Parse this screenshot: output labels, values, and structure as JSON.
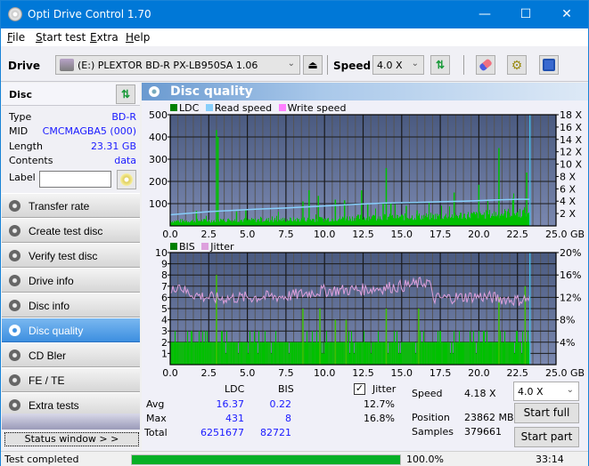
{
  "window": {
    "title": "Opti Drive Control 1.70",
    "minimize": "—",
    "maximize": "☐",
    "close": "✕"
  },
  "menu": [
    {
      "label": "File",
      "accel": "F",
      "rest": "ile"
    },
    {
      "label": "Start test",
      "accel": "S",
      "rest": "tart test"
    },
    {
      "label": "Extra",
      "accel": "E",
      "rest": "xtra"
    },
    {
      "label": "Help",
      "accel": "H",
      "rest": "elp"
    }
  ],
  "toolbar": {
    "drive_label": "Drive",
    "drive_value": "(E:)  PLEXTOR BD-R  PX-LB950SA 1.06",
    "speed_label": "Speed",
    "speed_value": "4.0 X",
    "icons": [
      "drive-icon",
      "eject-icon",
      "refresh-icon",
      "eraser-icon",
      "settings-icon",
      "save-icon"
    ]
  },
  "disc": {
    "header": "Disc",
    "fields": [
      {
        "key": "Type",
        "value": "BD-R"
      },
      {
        "key": "MID",
        "value": "CMCMAGBA5 (000)"
      },
      {
        "key": "Length",
        "value": "23.31 GB"
      },
      {
        "key": "Contents",
        "value": "data"
      }
    ],
    "label_key": "Label",
    "label_value": ""
  },
  "nav": [
    {
      "label": "Transfer rate",
      "active": false
    },
    {
      "label": "Create test disc",
      "active": false
    },
    {
      "label": "Verify test disc",
      "active": false
    },
    {
      "label": "Drive info",
      "active": false
    },
    {
      "label": "Disc info",
      "active": false
    },
    {
      "label": "Disc quality",
      "active": true
    },
    {
      "label": "CD Bler",
      "active": false
    },
    {
      "label": "FE / TE",
      "active": false
    },
    {
      "label": "Extra tests",
      "active": false
    }
  ],
  "status_window_button": "Status window > >",
  "panel": {
    "title": "Disc quality"
  },
  "chart_data": [
    {
      "type": "bar",
      "title": "",
      "legend": [
        {
          "name": "LDC",
          "color": "#008000"
        },
        {
          "name": "Read speed",
          "color": "#87cefa"
        },
        {
          "name": "Write speed",
          "color": "#ff80ff"
        }
      ],
      "legend_position": "top-left",
      "xlabel": "GB",
      "xlim": [
        0,
        25
      ],
      "x_ticks": [
        "0.0",
        "2.5",
        "5.0",
        "7.5",
        "10.0",
        "12.5",
        "15.0",
        "17.5",
        "20.0",
        "22.5",
        "25.0 GB"
      ],
      "ylim": [
        0,
        500
      ],
      "y_ticks": [
        "100",
        "200",
        "300",
        "400",
        "500"
      ],
      "y2lim": [
        0,
        18
      ],
      "y2_ticks": [
        "2 X",
        "4 X",
        "6 X",
        "8 X",
        "10 X",
        "12 X",
        "14 X",
        "16 X",
        "18 X"
      ],
      "grid": true,
      "end_marker_gb": 23.31,
      "ldc_baseline": [
        [
          0,
          22
        ],
        [
          2.5,
          24
        ],
        [
          5,
          26
        ],
        [
          7.5,
          28
        ],
        [
          10,
          30
        ],
        [
          12.5,
          38
        ],
        [
          15,
          40
        ],
        [
          17.5,
          44
        ],
        [
          20,
          50
        ],
        [
          22.5,
          60
        ],
        [
          23.3,
          62
        ]
      ],
      "ldc_spikes": [
        [
          1.7,
          68
        ],
        [
          3.0,
          431
        ],
        [
          3.1,
          400
        ],
        [
          4.3,
          65
        ],
        [
          4.9,
          70
        ],
        [
          8.6,
          110
        ],
        [
          9.0,
          160
        ],
        [
          9.6,
          135
        ],
        [
          10.7,
          118
        ],
        [
          11.3,
          115
        ],
        [
          12.4,
          160
        ],
        [
          12.8,
          100
        ],
        [
          13.8,
          100
        ],
        [
          14.0,
          260
        ],
        [
          14.3,
          105
        ],
        [
          15.3,
          90
        ],
        [
          16.0,
          70
        ],
        [
          18.4,
          150
        ],
        [
          20.0,
          185
        ],
        [
          21.3,
          350
        ],
        [
          22.2,
          125
        ],
        [
          23.1,
          240
        ]
      ],
      "read_speed": [
        [
          0,
          1.8
        ],
        [
          1,
          2.0
        ],
        [
          2.5,
          2.3
        ],
        [
          4,
          2.5
        ],
        [
          5.5,
          2.7
        ],
        [
          7.5,
          2.9
        ],
        [
          9,
          3.1
        ],
        [
          10.5,
          3.3
        ],
        [
          12,
          3.5
        ],
        [
          14,
          3.7
        ],
        [
          16,
          3.8
        ],
        [
          17.5,
          3.9
        ],
        [
          19,
          4.0
        ],
        [
          21,
          4.2
        ],
        [
          22.5,
          4.3
        ],
        [
          23.3,
          4.3
        ]
      ]
    },
    {
      "type": "bar",
      "title": "",
      "legend": [
        {
          "name": "BIS",
          "color": "#008000"
        },
        {
          "name": "Jitter",
          "color": "#dda0dd"
        }
      ],
      "legend_position": "top-left",
      "xlabel": "GB",
      "xlim": [
        0,
        25
      ],
      "x_ticks": [
        "0.0",
        "2.5",
        "5.0",
        "7.5",
        "10.0",
        "12.5",
        "15.0",
        "17.5",
        "20.0",
        "22.5",
        "25.0 GB"
      ],
      "ylim": [
        0,
        10
      ],
      "y_ticks": [
        "1",
        "2",
        "3",
        "4",
        "5",
        "6",
        "7",
        "8",
        "9",
        "10"
      ],
      "y2lim": [
        0,
        20
      ],
      "y2_ticks": [
        "4%",
        "8%",
        "12%",
        "16%",
        "20%"
      ],
      "grid": true,
      "end_marker_gb": 23.31,
      "bis_level": 2,
      "bis_spikes": [
        [
          3.0,
          8
        ],
        [
          8.6,
          5
        ],
        [
          9.7,
          5
        ],
        [
          10.7,
          4
        ],
        [
          11.4,
          4
        ],
        [
          14.0,
          5
        ],
        [
          16.1,
          5
        ],
        [
          21.3,
          6
        ],
        [
          23.0,
          7
        ]
      ],
      "jitter_pct": [
        [
          0,
          12.5
        ],
        [
          0.5,
          14.5
        ],
        [
          1,
          13
        ],
        [
          2,
          12.2
        ],
        [
          3,
          11.8
        ],
        [
          5,
          12
        ],
        [
          7.5,
          12.2
        ],
        [
          10,
          13.2
        ],
        [
          12.5,
          13.4
        ],
        [
          15,
          14
        ],
        [
          16.8,
          14.8
        ],
        [
          17,
          11.8
        ],
        [
          20,
          12.2
        ],
        [
          22.5,
          11.5
        ],
        [
          23.3,
          11.8
        ]
      ]
    }
  ],
  "stats": {
    "col_ldc": "LDC",
    "col_bis": "BIS",
    "jitter_label": "Jitter",
    "jitter_checked": true,
    "rows": [
      {
        "label": "Avg",
        "ldc": "16.37",
        "bis": "0.22",
        "jitter": "12.7%"
      },
      {
        "label": "Max",
        "ldc": "431",
        "bis": "8",
        "jitter": "16.8%"
      },
      {
        "label": "Total",
        "ldc": "6251677",
        "bis": "82721",
        "jitter": ""
      }
    ],
    "speed_label": "Speed",
    "speed_value": "4.18 X",
    "position_label": "Position",
    "position_value": "23862 MB",
    "samples_label": "Samples",
    "samples_value": "379661",
    "speed_select": "4.0 X",
    "start_full": "Start full",
    "start_part": "Start part"
  },
  "statusbar": {
    "text": "Test completed",
    "progress_pct": 100,
    "progress_text": "100.0%",
    "time": "33:14"
  }
}
